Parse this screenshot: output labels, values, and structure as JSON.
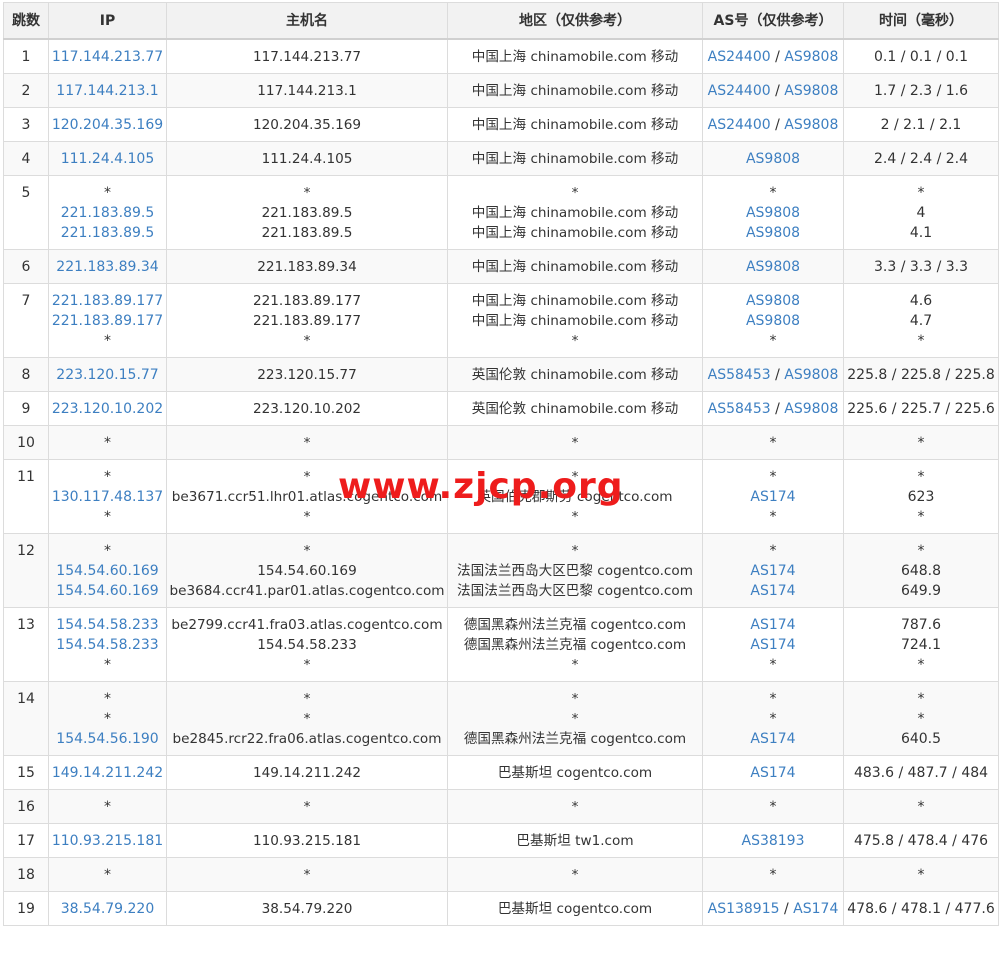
{
  "headers": [
    "跳数",
    "IP",
    "主机名",
    "地区（仅供参考）",
    "AS号（仅供参考）",
    "时间（毫秒）"
  ],
  "watermark": "www.zjcp.org",
  "colors": {
    "link": "#3d7fc1",
    "header_bg": "#f2f2f2",
    "watermark": "#ee1c1c",
    "border": "#dcdcdc"
  },
  "rows": [
    {
      "hop": "1",
      "ip": [
        "117.144.213.77"
      ],
      "host": [
        "117.144.213.77"
      ],
      "region": [
        "中国上海 chinamobile.com 移动"
      ],
      "as": [
        [
          "AS24400",
          "AS9808"
        ]
      ],
      "time": [
        "0.1 / 0.1 / 0.1"
      ]
    },
    {
      "hop": "2",
      "ip": [
        "117.144.213.1"
      ],
      "host": [
        "117.144.213.1"
      ],
      "region": [
        "中国上海 chinamobile.com 移动"
      ],
      "as": [
        [
          "AS24400",
          "AS9808"
        ]
      ],
      "time": [
        "1.7 / 2.3 / 1.6"
      ]
    },
    {
      "hop": "3",
      "ip": [
        "120.204.35.169"
      ],
      "host": [
        "120.204.35.169"
      ],
      "region": [
        "中国上海 chinamobile.com 移动"
      ],
      "as": [
        [
          "AS24400",
          "AS9808"
        ]
      ],
      "time": [
        "2 / 2.1 / 2.1"
      ]
    },
    {
      "hop": "4",
      "ip": [
        "111.24.4.105"
      ],
      "host": [
        "111.24.4.105"
      ],
      "region": [
        "中国上海 chinamobile.com 移动"
      ],
      "as": [
        [
          "AS9808"
        ]
      ],
      "time": [
        "2.4 / 2.4 / 2.4"
      ]
    },
    {
      "hop": "5",
      "ip": [
        "*",
        "221.183.89.5",
        "221.183.89.5"
      ],
      "host": [
        "*",
        "221.183.89.5",
        "221.183.89.5"
      ],
      "region": [
        "*",
        "中国上海 chinamobile.com 移动",
        "中国上海 chinamobile.com 移动"
      ],
      "as": [
        [
          "*"
        ],
        [
          "AS9808"
        ],
        [
          "AS9808"
        ]
      ],
      "time": [
        "*",
        "4",
        "4.1"
      ]
    },
    {
      "hop": "6",
      "ip": [
        "221.183.89.34"
      ],
      "host": [
        "221.183.89.34"
      ],
      "region": [
        "中国上海 chinamobile.com 移动"
      ],
      "as": [
        [
          "AS9808"
        ]
      ],
      "time": [
        "3.3 / 3.3 / 3.3"
      ]
    },
    {
      "hop": "7",
      "ip": [
        "221.183.89.177",
        "221.183.89.177",
        "*"
      ],
      "host": [
        "221.183.89.177",
        "221.183.89.177",
        "*"
      ],
      "region": [
        "中国上海 chinamobile.com 移动",
        "中国上海 chinamobile.com 移动",
        "*"
      ],
      "as": [
        [
          "AS9808"
        ],
        [
          "AS9808"
        ],
        [
          "*"
        ]
      ],
      "time": [
        "4.6",
        "4.7",
        "*"
      ]
    },
    {
      "hop": "8",
      "ip": [
        "223.120.15.77"
      ],
      "host": [
        "223.120.15.77"
      ],
      "region": [
        "英国伦敦 chinamobile.com 移动"
      ],
      "as": [
        [
          "AS58453",
          "AS9808"
        ]
      ],
      "time": [
        "225.8 / 225.8 / 225.8"
      ]
    },
    {
      "hop": "9",
      "ip": [
        "223.120.10.202"
      ],
      "host": [
        "223.120.10.202"
      ],
      "region": [
        "英国伦敦 chinamobile.com 移动"
      ],
      "as": [
        [
          "AS58453",
          "AS9808"
        ]
      ],
      "time": [
        "225.6 / 225.7 / 225.6"
      ]
    },
    {
      "hop": "10",
      "ip": [
        "*"
      ],
      "host": [
        "*"
      ],
      "region": [
        "*"
      ],
      "as": [
        [
          "*"
        ]
      ],
      "time": [
        "*"
      ]
    },
    {
      "hop": "11",
      "ip": [
        "*",
        "130.117.48.137",
        "*"
      ],
      "host": [
        "*",
        "be3671.ccr51.lhr01.atlas.cogentco.com",
        "*"
      ],
      "region": [
        "*",
        "英国伯克郡斯劳 cogentco.com",
        "*"
      ],
      "as": [
        [
          "*"
        ],
        [
          "AS174"
        ],
        [
          "*"
        ]
      ],
      "time": [
        "*",
        "623",
        "*"
      ]
    },
    {
      "hop": "12",
      "ip": [
        "*",
        "154.54.60.169",
        "154.54.60.169"
      ],
      "host": [
        "*",
        "154.54.60.169",
        "be3684.ccr41.par01.atlas.cogentco.com"
      ],
      "region": [
        "*",
        "法国法兰西岛大区巴黎 cogentco.com",
        "法国法兰西岛大区巴黎 cogentco.com"
      ],
      "as": [
        [
          "*"
        ],
        [
          "AS174"
        ],
        [
          "AS174"
        ]
      ],
      "time": [
        "*",
        "648.8",
        "649.9"
      ]
    },
    {
      "hop": "13",
      "ip": [
        "154.54.58.233",
        "154.54.58.233",
        "*"
      ],
      "host": [
        "be2799.ccr41.fra03.atlas.cogentco.com",
        "154.54.58.233",
        "*"
      ],
      "region": [
        "德国黑森州法兰克福 cogentco.com",
        "德国黑森州法兰克福 cogentco.com",
        "*"
      ],
      "as": [
        [
          "AS174"
        ],
        [
          "AS174"
        ],
        [
          "*"
        ]
      ],
      "time": [
        "787.6",
        "724.1",
        "*"
      ]
    },
    {
      "hop": "14",
      "ip": [
        "*",
        "*",
        "154.54.56.190"
      ],
      "host": [
        "*",
        "*",
        "be2845.rcr22.fra06.atlas.cogentco.com"
      ],
      "region": [
        "*",
        "*",
        "德国黑森州法兰克福 cogentco.com"
      ],
      "as": [
        [
          "*"
        ],
        [
          "*"
        ],
        [
          "AS174"
        ]
      ],
      "time": [
        "*",
        "*",
        "640.5"
      ]
    },
    {
      "hop": "15",
      "ip": [
        "149.14.211.242"
      ],
      "host": [
        "149.14.211.242"
      ],
      "region": [
        "巴基斯坦 cogentco.com"
      ],
      "as": [
        [
          "AS174"
        ]
      ],
      "time": [
        "483.6 / 487.7 / 484"
      ]
    },
    {
      "hop": "16",
      "ip": [
        "*"
      ],
      "host": [
        "*"
      ],
      "region": [
        "*"
      ],
      "as": [
        [
          "*"
        ]
      ],
      "time": [
        "*"
      ]
    },
    {
      "hop": "17",
      "ip": [
        "110.93.215.181"
      ],
      "host": [
        "110.93.215.181"
      ],
      "region": [
        "巴基斯坦 tw1.com"
      ],
      "as": [
        [
          "AS38193"
        ]
      ],
      "time": [
        "475.8 / 478.4 / 476"
      ]
    },
    {
      "hop": "18",
      "ip": [
        "*"
      ],
      "host": [
        "*"
      ],
      "region": [
        "*"
      ],
      "as": [
        [
          "*"
        ]
      ],
      "time": [
        "*"
      ]
    },
    {
      "hop": "19",
      "ip": [
        "38.54.79.220"
      ],
      "host": [
        "38.54.79.220"
      ],
      "region": [
        "巴基斯坦 cogentco.com"
      ],
      "as": [
        [
          "AS138915",
          "AS174"
        ]
      ],
      "time": [
        "478.6 / 478.1 / 477.6"
      ]
    }
  ]
}
